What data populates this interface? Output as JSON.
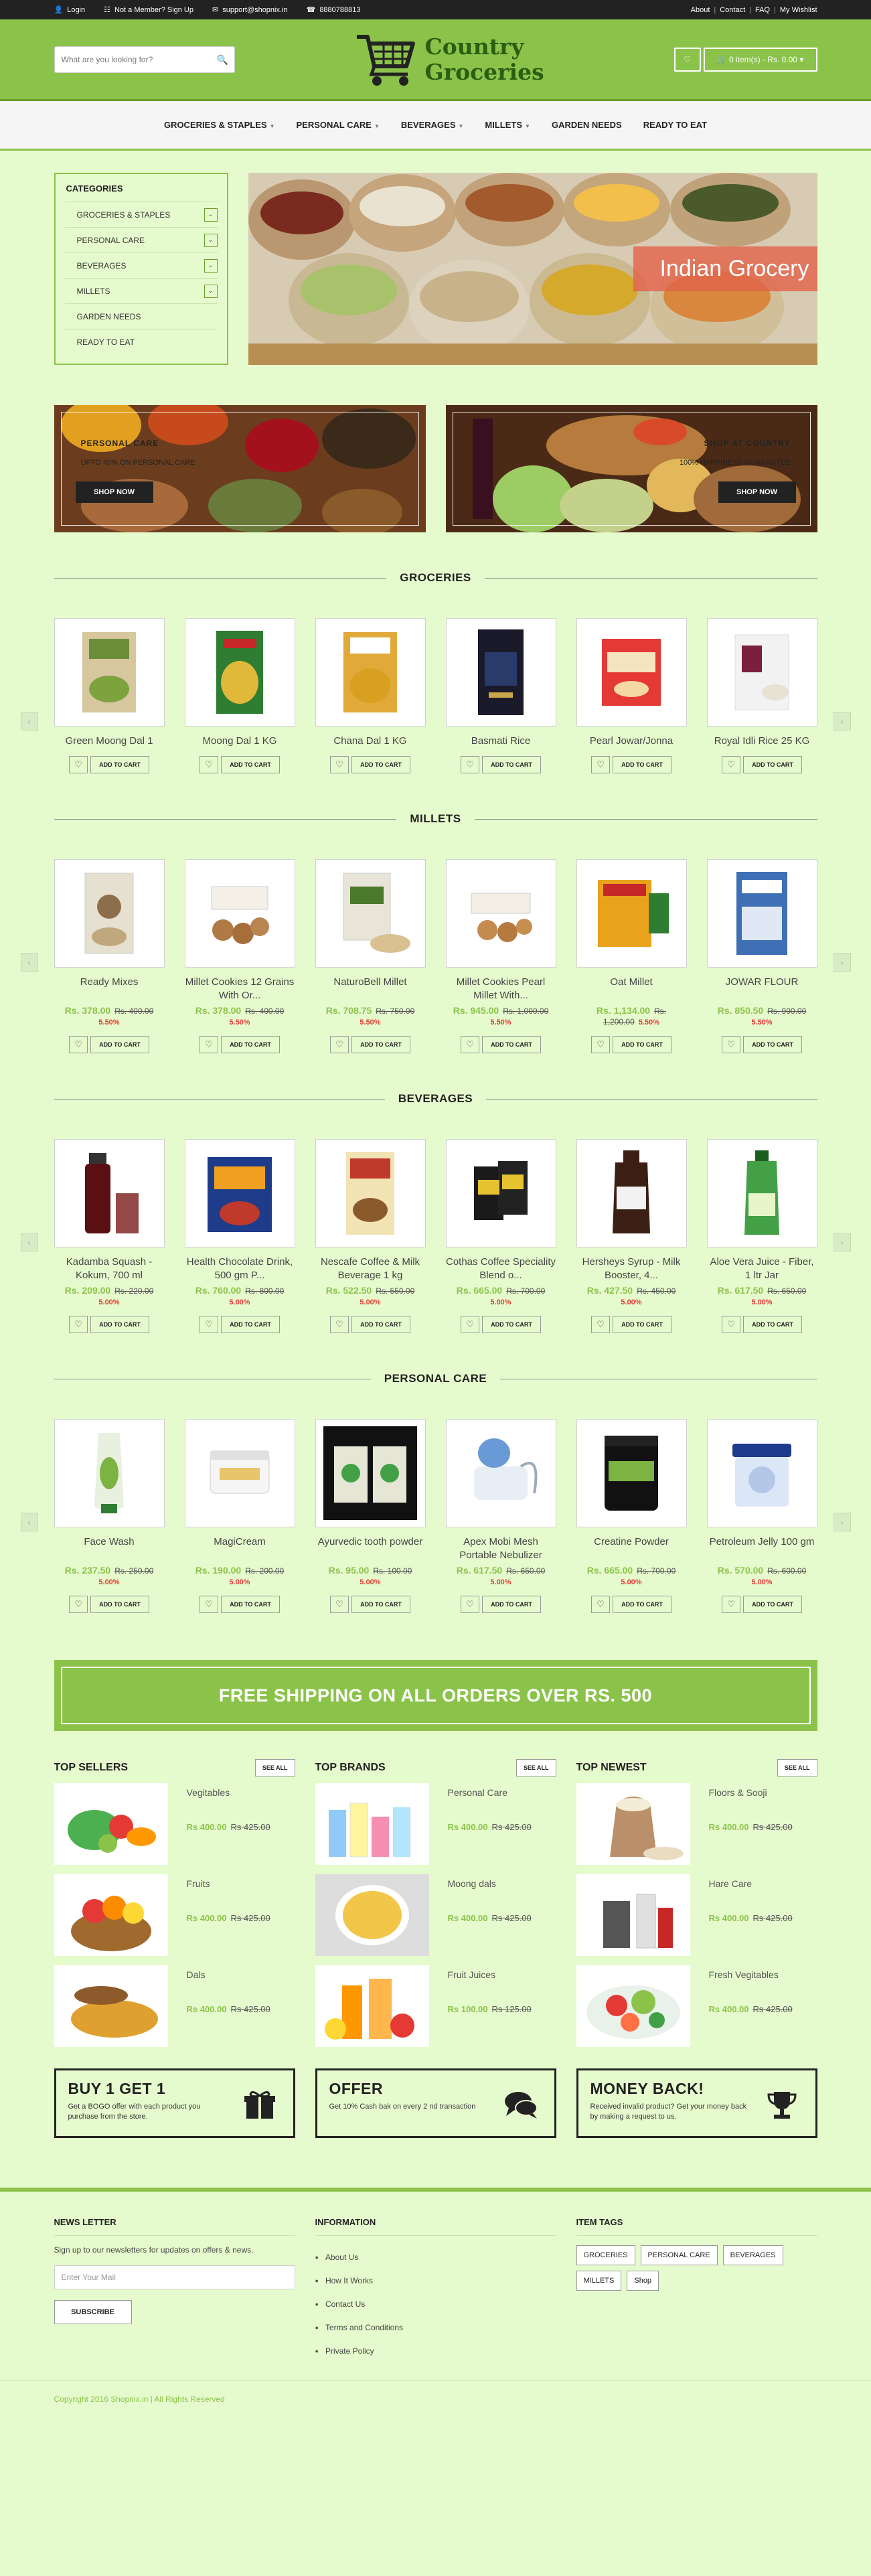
{
  "topbar": {
    "login": "Login",
    "member": "Not a Member? Sign Up",
    "email": "support@shopnix.in",
    "phone": "8880788813",
    "links": [
      "About",
      "Contact",
      "FAQ",
      "My Wishlist"
    ]
  },
  "header": {
    "search_placeholder": "What are you looking for?",
    "logo_line1": "Country",
    "logo_line2": "Groceries",
    "cart_label": "0 item(s) - Rs. 0.00"
  },
  "nav": [
    "GROCERIES & STAPLES",
    "PERSONAL CARE",
    "BEVERAGES",
    "MILLETS",
    "GARDEN NEEDS",
    "READY TO EAT"
  ],
  "categories": {
    "title": "CATEGORIES",
    "items": [
      "GROCERIES & STAPLES",
      "PERSONAL CARE",
      "BEVERAGES",
      "MILLETS",
      "GARDEN NEEDS",
      "READY TO EAT"
    ]
  },
  "hero": {
    "label": "Indian Grocery"
  },
  "banners": [
    {
      "title": "PERSONAL    CARE",
      "sub": "UPTO 40% ON PERSONAL CARE",
      "button": "SHOP NOW"
    },
    {
      "title": "SHOP AT COUNTRY",
      "sub": "100% HAPPINESS GUARANTEE",
      "button": "SHOP NOW"
    }
  ],
  "sections": {
    "groceries": {
      "title": "GROCERIES",
      "products": [
        {
          "name": "Green Moong Dal 1"
        },
        {
          "name": "Moong Dal 1 KG"
        },
        {
          "name": "Chana Dal 1 KG"
        },
        {
          "name": "Basmati Rice"
        },
        {
          "name": "Pearl Jowar/Jonna"
        },
        {
          "name": "Royal Idli Rice 25 KG"
        }
      ]
    },
    "millets": {
      "title": "MILLETS",
      "products": [
        {
          "name": "Ready Mixes",
          "price": "Rs. 378.00",
          "old": "Rs. 400.00",
          "disc": "5.50%"
        },
        {
          "name": "Millet Cookies 12 Grains With Or...",
          "price": "Rs. 378.00",
          "old": "Rs. 400.00",
          "disc": "5.50%"
        },
        {
          "name": "NaturoBell Millet",
          "price": "Rs. 708.75",
          "old": "Rs. 750.00",
          "disc": "5.50%"
        },
        {
          "name": "Millet Cookies Pearl Millet With...",
          "price": "Rs. 945.00",
          "old": "Rs. 1,000.00",
          "disc": "5.50%"
        },
        {
          "name": "Oat Millet",
          "price": "Rs. 1,134.00",
          "old": "Rs. 1,200.00",
          "disc": "5.50%"
        },
        {
          "name": "JOWAR FLOUR",
          "price": "Rs. 850.50",
          "old": "Rs. 900.00",
          "disc": "5.50%"
        }
      ]
    },
    "beverages": {
      "title": "BEVERAGES",
      "products": [
        {
          "name": "Kadamba Squash - Kokum, 700 ml",
          "price": "Rs. 209.00",
          "old": "Rs. 220.00",
          "disc": "5.00%"
        },
        {
          "name": "Health Chocolate Drink, 500 gm P...",
          "price": "Rs. 760.00",
          "old": "Rs. 800.00",
          "disc": "5.00%"
        },
        {
          "name": "Nescafe Coffee & Milk Beverage 1 kg",
          "price": "Rs. 522.50",
          "old": "Rs. 550.00",
          "disc": "5.00%"
        },
        {
          "name": "Cothas Coffee Speciality Blend o...",
          "price": "Rs. 665.00",
          "old": "Rs. 700.00",
          "disc": "5.00%"
        },
        {
          "name": "Hersheys Syrup - Milk Booster, 4...",
          "price": "Rs. 427.50",
          "old": "Rs. 450.00",
          "disc": "5.00%"
        },
        {
          "name": "Aloe Vera Juice - Fiber, 1 ltr Jar",
          "price": "Rs. 617.50",
          "old": "Rs. 650.00",
          "disc": "5.00%"
        }
      ]
    },
    "personal": {
      "title": "PERSONAL CARE",
      "products": [
        {
          "name": "Face Wash",
          "price": "Rs. 237.50",
          "old": "Rs. 250.00",
          "disc": "5.00%"
        },
        {
          "name": "MagiCream",
          "price": "Rs. 190.00",
          "old": "Rs. 200.00",
          "disc": "5.00%"
        },
        {
          "name": "Ayurvedic tooth powder",
          "price": "Rs. 95.00",
          "old": "Rs. 100.00",
          "disc": "5.00%"
        },
        {
          "name": "Apex Mobi Mesh Portable Nebulizer",
          "price": "Rs. 617.50",
          "old": "Rs. 650.00",
          "disc": "5.00%"
        },
        {
          "name": "Creatine Powder",
          "price": "Rs. 665.00",
          "old": "Rs. 700.00",
          "disc": "5.00%"
        },
        {
          "name": "Petroleum Jelly 100 gm",
          "price": "Rs. 570.00",
          "old": "Rs. 600.00",
          "disc": "5.00%"
        }
      ]
    }
  },
  "add_to_cart": "ADD TO CART",
  "free_shipping": "FREE SHIPPING ON ALL ORDERS OVER RS. 500",
  "see_all": "SEE ALL",
  "lists": [
    {
      "title": "TOP SELLERS",
      "items": [
        {
          "name": "Vegitables",
          "price": "Rs 400.00",
          "old": "Rs 425.00"
        },
        {
          "name": "Fruits",
          "price": "Rs 400.00",
          "old": "Rs 425.00"
        },
        {
          "name": "Dals",
          "price": "Rs 400.00",
          "old": "Rs 425.00"
        }
      ]
    },
    {
      "title": "TOP BRANDS",
      "items": [
        {
          "name": "Personal Care",
          "price": "Rs 400.00",
          "old": "Rs 425.00"
        },
        {
          "name": "Moong dals",
          "price": "Rs 400.00",
          "old": "Rs 425.00"
        },
        {
          "name": "Fruit Juices",
          "price": "Rs 100.00",
          "old": "Rs 125.00"
        }
      ]
    },
    {
      "title": "TOP NEWEST",
      "items": [
        {
          "name": "Floors & Sooji",
          "price": "Rs 400.00",
          "old": "Rs 425.00"
        },
        {
          "name": "Hare Care",
          "price": "Rs 400.00",
          "old": "Rs 425.00"
        },
        {
          "name": "Fresh Vegitables",
          "price": "Rs 400.00",
          "old": "Rs 425.00"
        }
      ]
    }
  ],
  "promos": [
    {
      "title": "BUY 1 GET 1",
      "text": "Get a BOGO offer with each product you purchase from the store."
    },
    {
      "title": "OFFER",
      "text": "Get 10% Cash bak on every 2 nd transaction"
    },
    {
      "title": "MONEY BACK!",
      "text": "Received invalid product? Get your money back by making a request to us."
    }
  ],
  "footer": {
    "newsletter_title": "NEWS LETTER",
    "newsletter_text": "Sign up to our newsletters for updates on offers & news.",
    "email_placeholder": "Enter Your Mail",
    "subscribe": "SUBSCRIBE",
    "info_title": "INFORMATION",
    "info_links": [
      "About Us",
      "How It Works",
      "Contact Us",
      "Terms and Conditions",
      "Private Policy"
    ],
    "tags_title": "ITEM TAGS",
    "tags": [
      "GROCERIES",
      "PERSONAL CARE",
      "BEVERAGES",
      "MILLETS",
      "Shop"
    ],
    "copyright": "Copyright 2016 Shopnix.in | All Rights Reserved"
  },
  "colors": {
    "brand_green": "#8bc34a",
    "dark_green": "#2b5e12",
    "page_bg": "#e6fbcd",
    "discount_red": "#e53935"
  }
}
